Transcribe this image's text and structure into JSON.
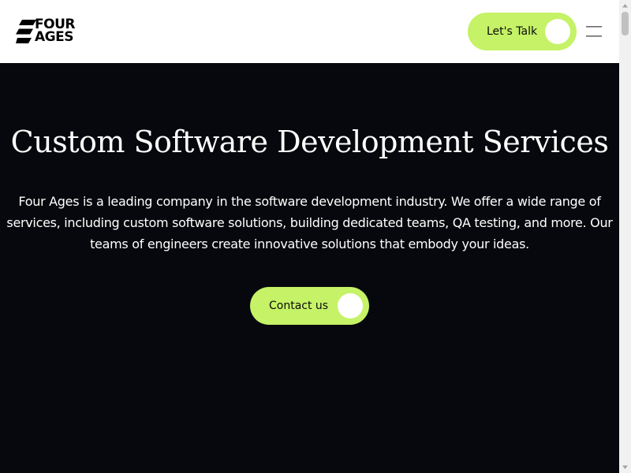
{
  "header": {
    "logo": {
      "line1": "FOUR",
      "line2": "AGES",
      "icon": "stripes-logo-icon"
    },
    "cta": {
      "label": "Let's Talk",
      "icon": "circle-dot-icon"
    },
    "menu": {
      "icon": "hamburger-menu-icon"
    }
  },
  "hero": {
    "title": "Custom Software Development Services",
    "description": "Four Ages is a leading company in the software development industry. We offer a wide range of services, including custom software solutions, building dedicated teams, QA testing, and more. Our teams of engineers create innovative solutions that embody your ideas.",
    "cta": {
      "label": "Contact us",
      "icon": "circle-dot-icon"
    }
  },
  "scrollbar": {
    "up_icon": "scroll-up-arrow-icon",
    "down_icon": "scroll-down-arrow-icon"
  },
  "colors": {
    "accent": "#c5f266",
    "hero_background": "#07080d",
    "header_background": "#ffffff",
    "text_on_dark": "#ffffff",
    "text_on_accent": "#0b0b0b"
  }
}
